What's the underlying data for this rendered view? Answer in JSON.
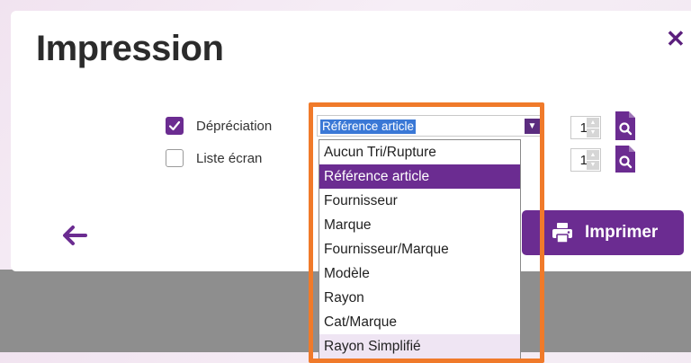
{
  "dialog": {
    "title": "Impression",
    "close_icon": "close-icon"
  },
  "options": [
    {
      "label": "Dépréciation",
      "checked": true,
      "sort_value": "Référence article",
      "copies": "1"
    },
    {
      "label": "Liste écran",
      "checked": false,
      "copies": "1"
    }
  ],
  "dropdown": {
    "items": [
      "Aucun Tri/Rupture",
      "Référence article",
      "Fournisseur",
      "Marque",
      "Fournisseur/Marque",
      "Modèle",
      "Rayon",
      "Cat/Marque",
      "Rayon Simplifié"
    ],
    "selected_index": 1
  },
  "footer": {
    "back_icon": "arrow-left-icon",
    "print_label": "Imprimer",
    "print_icon": "printer-icon"
  },
  "colors": {
    "accent": "#6b2c91",
    "highlight": "#f07a2a",
    "selection_text_bg": "#3a78d6"
  }
}
